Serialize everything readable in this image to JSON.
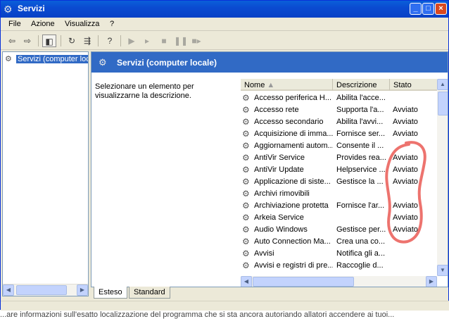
{
  "window": {
    "title": "Servizi"
  },
  "menu": [
    "File",
    "Azione",
    "Visualizza",
    "?"
  ],
  "tree": {
    "item": "Servizi (computer locale)"
  },
  "content": {
    "header": "Servizi (computer locale)",
    "description": "Selezionare un elemento per visualizzarne la descrizione."
  },
  "columns": [
    "Nome",
    "Descrizione",
    "Stato"
  ],
  "rows": [
    {
      "name": "Accesso periferica H...",
      "desc": "Abilita l'acce...",
      "state": ""
    },
    {
      "name": "Accesso rete",
      "desc": "Supporta l'a...",
      "state": "Avviato"
    },
    {
      "name": "Accesso secondario",
      "desc": "Abilita l'avvi...",
      "state": "Avviato"
    },
    {
      "name": "Acquisizione di imma...",
      "desc": "Fornisce ser...",
      "state": "Avviato"
    },
    {
      "name": "Aggiornamenti autom...",
      "desc": "Consente il ...",
      "state": ""
    },
    {
      "name": "AntiVir Service",
      "desc": "Provides rea...",
      "state": "Avviato"
    },
    {
      "name": "AntiVir Update",
      "desc": "Helpservice ...",
      "state": "Avviato"
    },
    {
      "name": "Applicazione di siste...",
      "desc": "Gestisce la ...",
      "state": "Avviato"
    },
    {
      "name": "Archivi rimovibili",
      "desc": "",
      "state": ""
    },
    {
      "name": "Archiviazione protetta",
      "desc": "Fornisce l'ar...",
      "state": "Avviato"
    },
    {
      "name": "Arkeia Service",
      "desc": "",
      "state": "Avviato"
    },
    {
      "name": "Audio Windows",
      "desc": "Gestisce per...",
      "state": "Avviato"
    },
    {
      "name": "Auto Connection Ma...",
      "desc": "Crea una co...",
      "state": ""
    },
    {
      "name": "Avvisi",
      "desc": "Notifica gli a...",
      "state": ""
    },
    {
      "name": "Avvisi e registri di pre...",
      "desc": "Raccoglie d...",
      "state": ""
    }
  ],
  "tabs": [
    "Esteso",
    "Standard"
  ],
  "below_text": "...are informazioni sull'esatto localizzazione del programma che si sta ancora autoriando allatori accendere ai tuoi..."
}
